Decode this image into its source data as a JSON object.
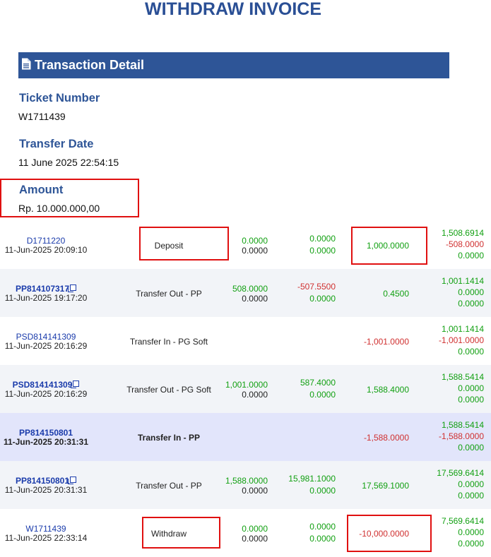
{
  "page": {
    "title": "WITHDRAW INVOICE"
  },
  "section": {
    "title": "Transaction Detail",
    "icon": "document-icon"
  },
  "details": {
    "ticket_label": "Ticket Number",
    "ticket_value": "W1711439",
    "date_label": "Transfer Date",
    "date_value": "11 June 2025 22:54:15",
    "amount_label": "Amount",
    "amount_value": "Rp. 10.000.000,00"
  },
  "colors": {
    "accent": "#2e5597",
    "positive": "#12a012",
    "negative": "#d03030",
    "link": "#1a3bab",
    "highlight_box": "#e01010"
  },
  "transactions": [
    {
      "ref": "D1711220",
      "date": "11-Jun-2025 20:09:10",
      "type": "Deposit",
      "copy_icon": false,
      "c1": [
        "0.0000",
        "0.0000"
      ],
      "c2": [
        "0.0000",
        "0.0000"
      ],
      "c3": "1,000.0000",
      "bal": [
        "1,508.6914",
        "-508.0000",
        "0.0000"
      ]
    },
    {
      "ref": "PP814107317",
      "date": "11-Jun-2025 19:17:20",
      "type": "Transfer Out - PP",
      "copy_icon": true,
      "c1": [
        "508.0000",
        "0.0000"
      ],
      "c2": [
        "-507.5500",
        "0.0000"
      ],
      "c3": "0.4500",
      "bal": [
        "1,001.1414",
        "0.0000",
        "0.0000"
      ]
    },
    {
      "ref": "PSD814141309",
      "date": "11-Jun-2025 20:16:29",
      "type": "Transfer In - PG Soft",
      "copy_icon": false,
      "c1": [
        "",
        ""
      ],
      "c2": [
        "",
        ""
      ],
      "c3": "-1,001.0000",
      "bal": [
        "1,001.1414",
        "-1,001.0000",
        "0.0000"
      ]
    },
    {
      "ref": "PSD814141309",
      "date": "11-Jun-2025 20:16:29",
      "type": "Transfer Out - PG Soft",
      "copy_icon": true,
      "c1": [
        "1,001.0000",
        "0.0000"
      ],
      "c2": [
        "587.4000",
        "0.0000"
      ],
      "c3": "1,588.4000",
      "bal": [
        "1,588.5414",
        "0.0000",
        "0.0000"
      ]
    },
    {
      "ref": "PP814150801",
      "date": "11-Jun-2025 20:31:31",
      "type": "Transfer In - PP",
      "copy_icon": false,
      "c1": [
        "",
        ""
      ],
      "c2": [
        "",
        ""
      ],
      "c3": "-1,588.0000",
      "bal": [
        "1,588.5414",
        "-1,588.0000",
        "0.0000"
      ]
    },
    {
      "ref": "PP814150801",
      "date": "11-Jun-2025 20:31:31",
      "type": "Transfer Out - PP",
      "copy_icon": true,
      "c1": [
        "1,588.0000",
        "0.0000"
      ],
      "c2": [
        "15,981.1000",
        "0.0000"
      ],
      "c3": "17,569.1000",
      "bal": [
        "17,569.6414",
        "0.0000",
        "0.0000"
      ]
    },
    {
      "ref": "W1711439",
      "date": "11-Jun-2025 22:33:14",
      "type": "Withdraw",
      "copy_icon": false,
      "c1": [
        "0.0000",
        "0.0000"
      ],
      "c2": [
        "0.0000",
        "0.0000"
      ],
      "c3": "-10,000.0000",
      "bal": [
        "7,569.6414",
        "0.0000",
        "0.0000"
      ]
    }
  ]
}
